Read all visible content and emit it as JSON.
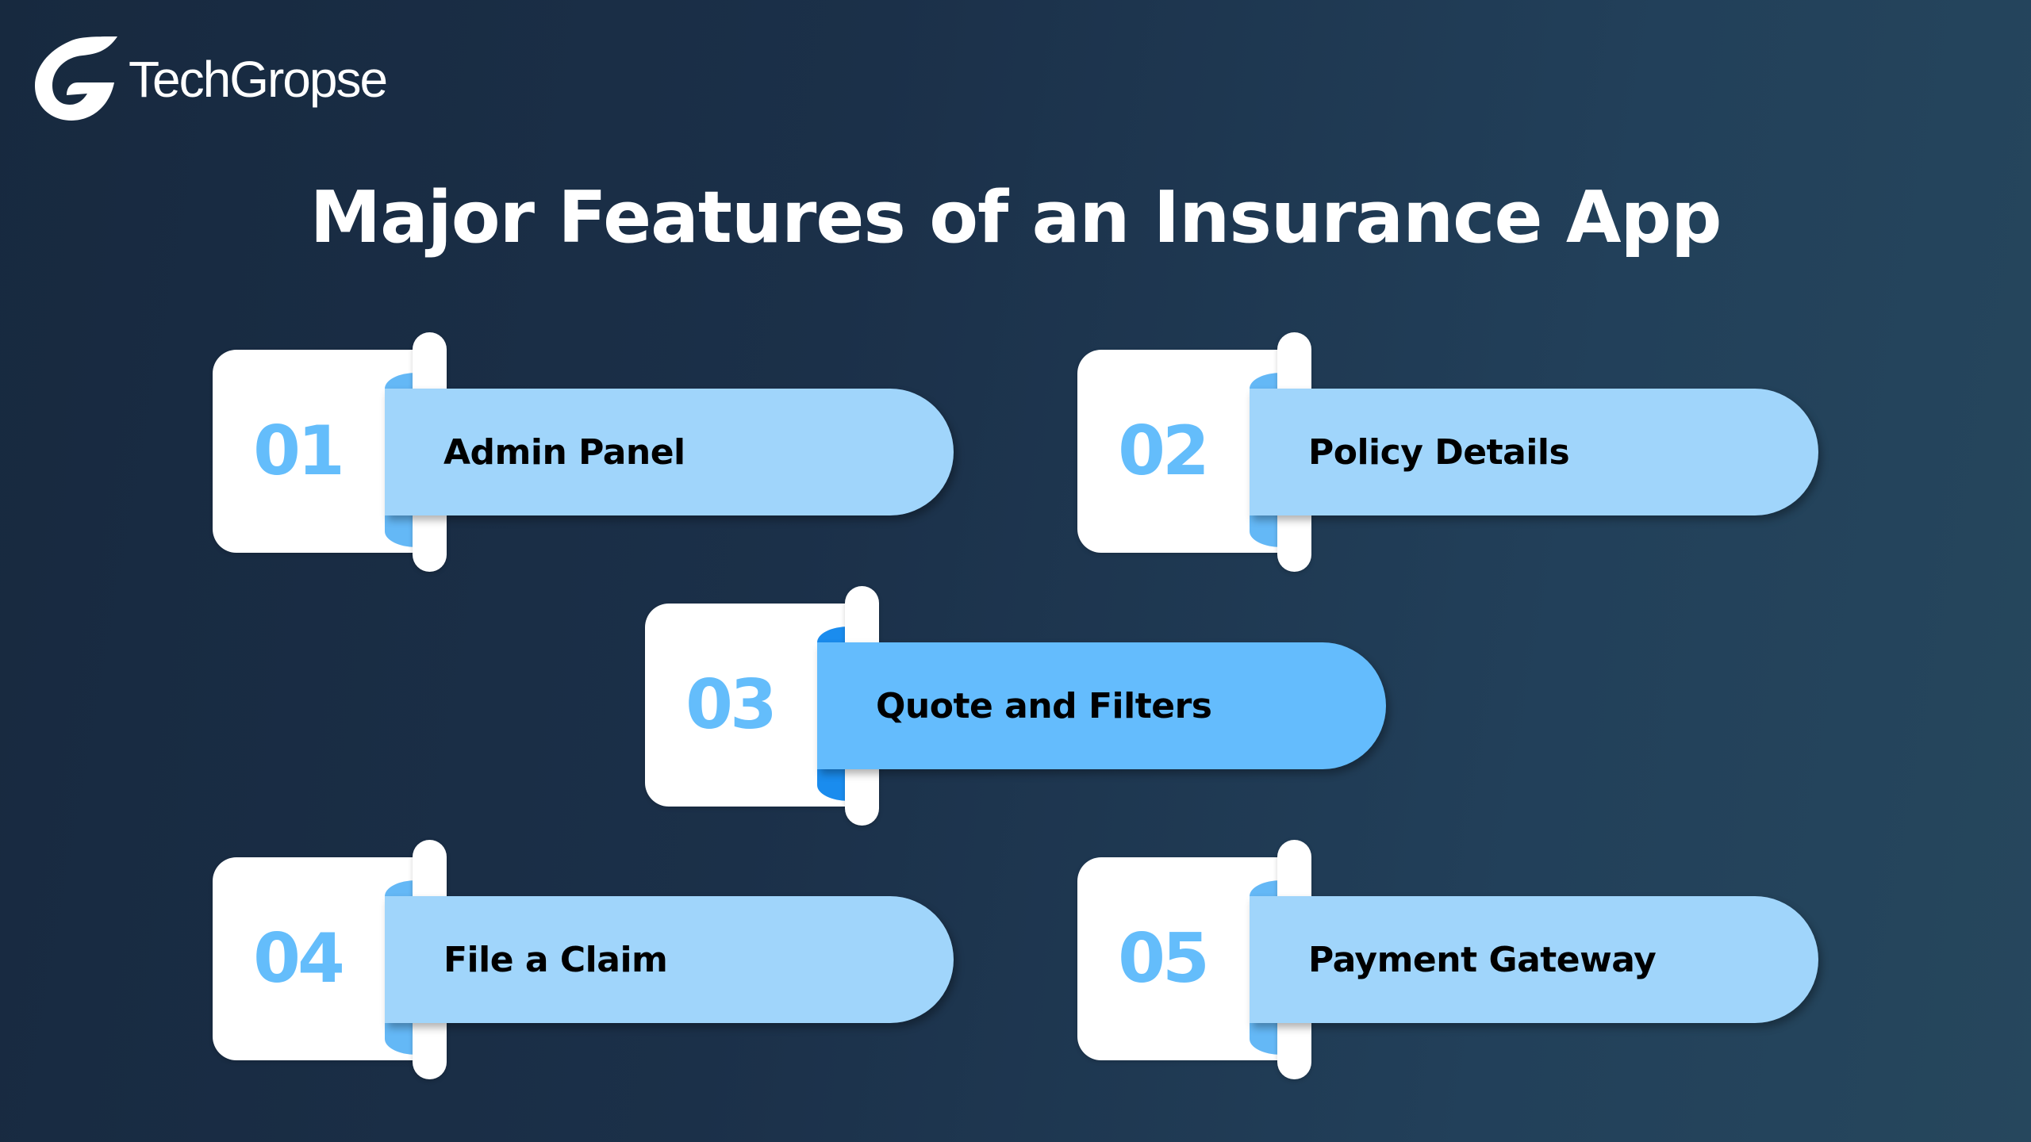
{
  "brand": {
    "name": "TechGropse",
    "logo_icon": "g-logo-icon"
  },
  "title": "Major Features of an Insurance App",
  "colors": {
    "background_left": "#17293f",
    "background_right": "#26475d",
    "box": "#ffffff",
    "number": "#64bdfb",
    "ribbon_light": "#a0d5fb",
    "ribbon_light_fold": "#64b8f6",
    "ribbon_highlight": "#64bcfd",
    "ribbon_highlight_fold": "#1a8cee",
    "label": "#000000",
    "title": "#ffffff"
  },
  "features": [
    {
      "number": "01",
      "label": "Admin Panel",
      "highlight": false
    },
    {
      "number": "02",
      "label": "Policy Details",
      "highlight": false
    },
    {
      "number": "03",
      "label": "Quote and Filters",
      "highlight": true
    },
    {
      "number": "04",
      "label": "File a Claim",
      "highlight": false
    },
    {
      "number": "05",
      "label": "Payment Gateway",
      "highlight": false
    }
  ]
}
